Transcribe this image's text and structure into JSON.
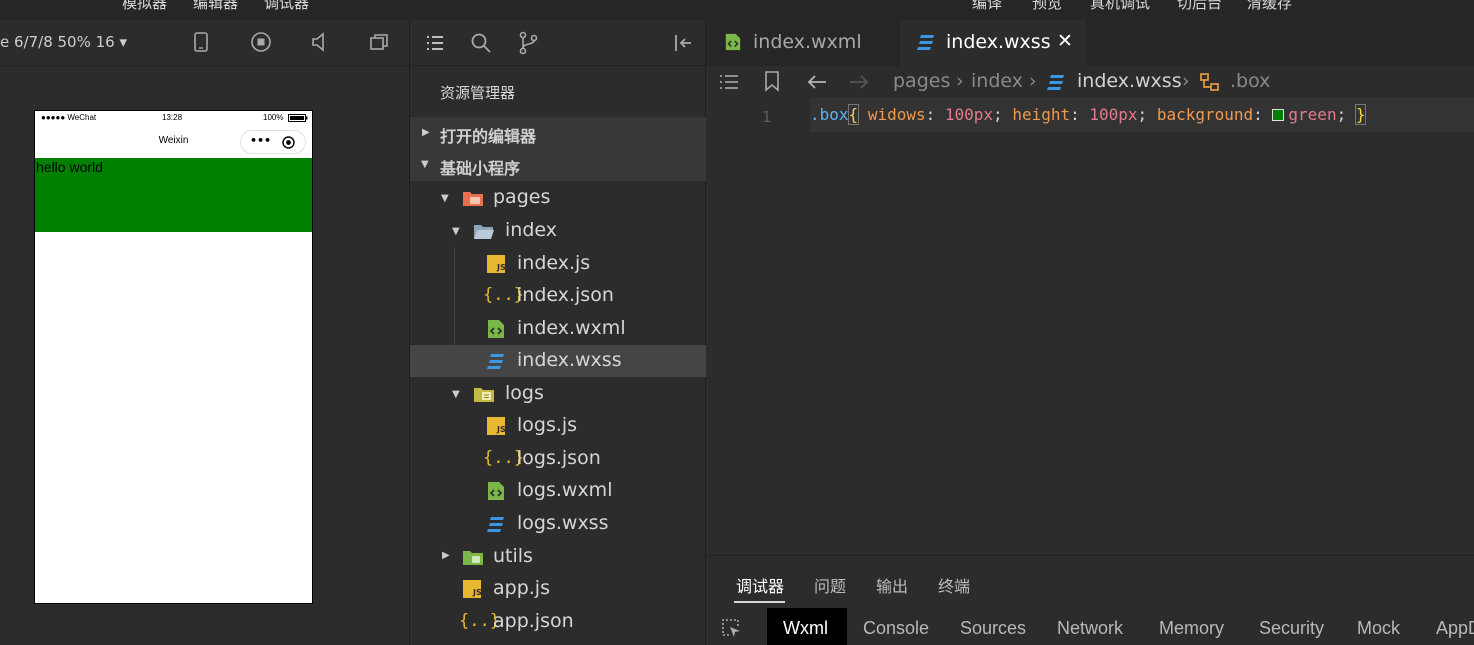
{
  "menu": {
    "left": [
      "模拟器",
      "编辑器",
      "调试器"
    ],
    "right": [
      "编译",
      "预览",
      "真机调试",
      "切后台",
      "清缓存"
    ]
  },
  "simulator": {
    "device_label": "e 6/7/8 50% 16 ▾",
    "phone": {
      "carrier": "●●●●● WeChat",
      "time": "13:28",
      "battery": "100%",
      "nav_title": "Weixin",
      "capsule_more": "•••",
      "box_text": "hello world"
    }
  },
  "explorer": {
    "title": "资源管理器",
    "sections": {
      "open_editors": "打开的编辑器",
      "project": "基础小程序"
    },
    "tree": [
      {
        "label": "pages",
        "icon": "pages-folder-icon",
        "depth": 0,
        "expanded": true
      },
      {
        "label": "index",
        "icon": "folder-open-icon",
        "depth": 1,
        "expanded": true
      },
      {
        "label": "index.js",
        "icon": "js-file-icon",
        "depth": 2
      },
      {
        "label": "index.json",
        "icon": "json-file-icon",
        "depth": 2
      },
      {
        "label": "index.wxml",
        "icon": "wxml-file-icon",
        "depth": 2
      },
      {
        "label": "index.wxss",
        "icon": "wxss-file-icon",
        "depth": 2,
        "selected": true
      },
      {
        "label": "logs",
        "icon": "logs-folder-icon",
        "depth": 1,
        "expanded": true
      },
      {
        "label": "logs.js",
        "icon": "js-file-icon",
        "depth": 2
      },
      {
        "label": "logs.json",
        "icon": "json-file-icon",
        "depth": 2
      },
      {
        "label": "logs.wxml",
        "icon": "wxml-file-icon",
        "depth": 2
      },
      {
        "label": "logs.wxss",
        "icon": "wxss-file-icon",
        "depth": 2
      },
      {
        "label": "utils",
        "icon": "utils-folder-icon",
        "depth": 0,
        "expanded": false
      },
      {
        "label": "app.js",
        "icon": "js-file-icon",
        "depth": 0
      },
      {
        "label": "app.json",
        "icon": "json-file-icon",
        "depth": 0
      }
    ]
  },
  "editor": {
    "tabs": [
      {
        "label": "index.wxml",
        "active": false
      },
      {
        "label": "index.wxss",
        "active": true,
        "close": "✕"
      }
    ],
    "breadcrumb": [
      "pages",
      "index",
      "index.wxss",
      ".box"
    ],
    "line_number": "1",
    "code": {
      "selector": ".box",
      "open_brace": "{",
      "prop1": "widows",
      "val1": "100px",
      "prop2": "height",
      "val2": "100px",
      "prop3": "background",
      "val3": "green",
      "close_brace": "}"
    }
  },
  "debugger": {
    "tabs": [
      "调试器",
      "问题",
      "输出",
      "终端"
    ],
    "panel_tabs": [
      "Wxml",
      "Console",
      "Sources",
      "Network",
      "Memory",
      "Security",
      "Mock",
      "AppD"
    ]
  },
  "colors": {
    "box_green": "#008000",
    "selector": "#5ab4f0",
    "property": "#ef9a50",
    "value": "#e57a8a"
  }
}
